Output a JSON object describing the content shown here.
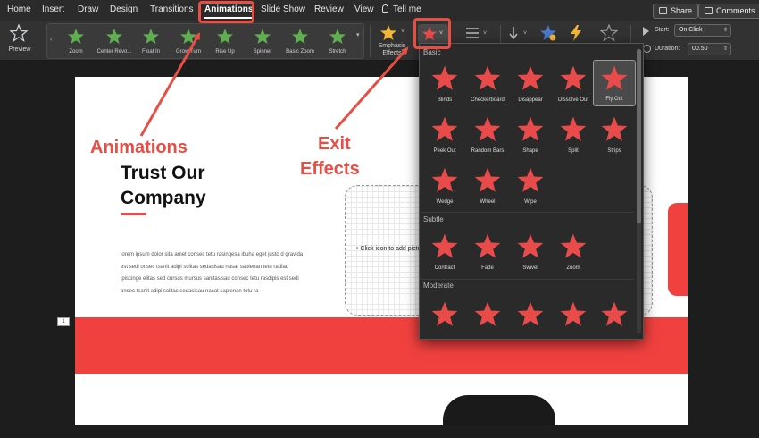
{
  "menu": {
    "tabs": [
      "Home",
      "Insert",
      "Draw",
      "Design",
      "Transitions",
      "Animations",
      "Slide Show",
      "Review",
      "View"
    ],
    "tell_me": "Tell me",
    "share": "Share",
    "comments": "Comments"
  },
  "ribbon": {
    "preview_label": "Preview",
    "gallery": [
      "Zoom",
      "Center Revo...",
      "Float In",
      "Grow/Turn",
      "Rise Up",
      "Spinner",
      "Basic Zoom",
      "Stretch"
    ],
    "emphasis_label": "Emphasis Effects",
    "start_label": "Start:",
    "start_value": "On Click",
    "duration_label": "Duration:",
    "duration_value": "00.50"
  },
  "slide": {
    "title_line1": "Trust Our",
    "title_line2": "Company",
    "body": "lorem ipsum dolor sita amet consec tetu rasingesa ibuha eget justo d gravida est sedi onsec tsanit adipi sclitas sedasisau nasat sapienan tetu radiad ipiscinge elitas sed cursus mursus sanitasisau consec tetu rasdipis est sedi onsec tsanit adipi sclitas sedasisau nasat sapienan tetu ra",
    "placeholder_text": "Click icon to add picture",
    "slide_number": "1"
  },
  "exit_panel": {
    "sections": [
      {
        "name": "Basic",
        "items": [
          "Blinds",
          "Checkerboard",
          "Disappear",
          "Dissolve Out",
          "Fly Out",
          "Peek Out",
          "Random Bars",
          "Shape",
          "Split",
          "Strips",
          "Wedge",
          "Wheel",
          "Wipe"
        ]
      },
      {
        "name": "Subtle",
        "items": [
          "Contract",
          "Fade",
          "Swivel",
          "Zoom"
        ]
      },
      {
        "name": "Moderate",
        "items": [
          "",
          "",
          "",
          "",
          ""
        ]
      }
    ],
    "selected": "Fly Out",
    "accent_color": "#e94b4b"
  },
  "annotations": {
    "animations_label": "Animations",
    "exit_label_line1": "Exit",
    "exit_label_line2": "Effects",
    "color": "#e94e45"
  }
}
